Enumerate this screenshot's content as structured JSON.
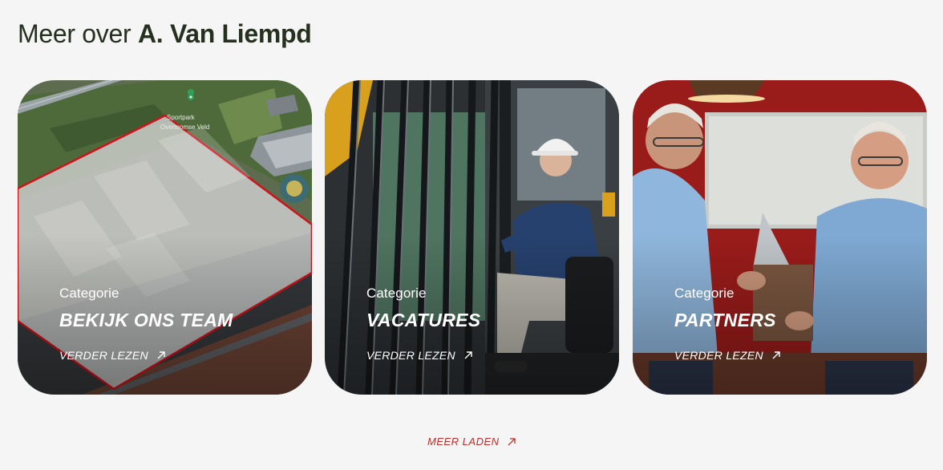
{
  "header": {
    "title_prefix": "Meer over",
    "title_brand": "A. Van Liempd"
  },
  "cards": [
    {
      "category": "Categorie",
      "title": "Bekijk ons team",
      "link": "VERDER LEZEN",
      "map_labels": [
        "Sportpark",
        "Overtoomse Veld"
      ]
    },
    {
      "category": "Categorie",
      "title": "Vacatures",
      "link": "VERDER LEZEN"
    },
    {
      "category": "Categorie",
      "title": "Partners",
      "link": "VERDER LEZEN"
    }
  ],
  "load_more": "MEER LADEN",
  "colors": {
    "background": "#f5f5f5",
    "accent_red": "#b9302c",
    "title_text": "#26301f"
  },
  "icons": {
    "link_arrow": "arrow-up-right-icon",
    "map_pin": "map-pin-icon"
  }
}
